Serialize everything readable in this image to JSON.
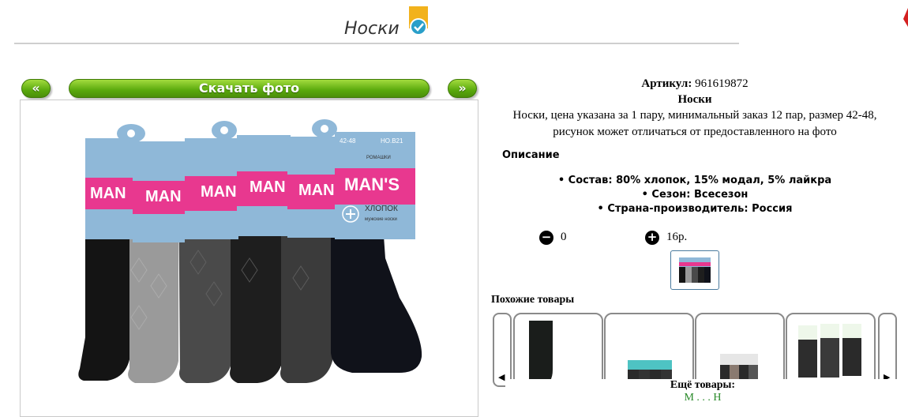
{
  "header": {
    "title": "Носки"
  },
  "nav": {
    "prev_label": "«",
    "download_label": "Скачать фото",
    "next_label": "»"
  },
  "product": {
    "sku_label": "Артикул:",
    "sku_value": "961619872",
    "name": "Носки",
    "description_line1": "Носки, цена указана за 1 пару, минимальный заказ 12 пар, размер 42-48,",
    "description_line2": "рисунок может отличаться от предоставленного на фото",
    "description_heading": "Описание",
    "properties": [
      "Состав: 80% хлопок, 15% модал, 5% лайкра",
      "Сезон: Всесезон",
      "Страна-производитель: Россия"
    ]
  },
  "photo": {
    "size_label": "42-48",
    "brand": "MAN'S",
    "tag_text": "ХЛОПОК",
    "tag_sub": "мужские носки",
    "maker": "РОМАШКИ",
    "code": "НО.B21"
  },
  "rating": {
    "minus_value": "0",
    "plus_value": "16р."
  },
  "similar": {
    "heading": "Похожие товары",
    "left_arrow": "◀",
    "right_arrow": "▶"
  },
  "more": {
    "label": "Ещё товары:",
    "sub": "М . . . Н"
  },
  "colors": {
    "green": "#5aa90d",
    "pink": "#e8388f",
    "sock_blue": "#8fb8d8"
  }
}
